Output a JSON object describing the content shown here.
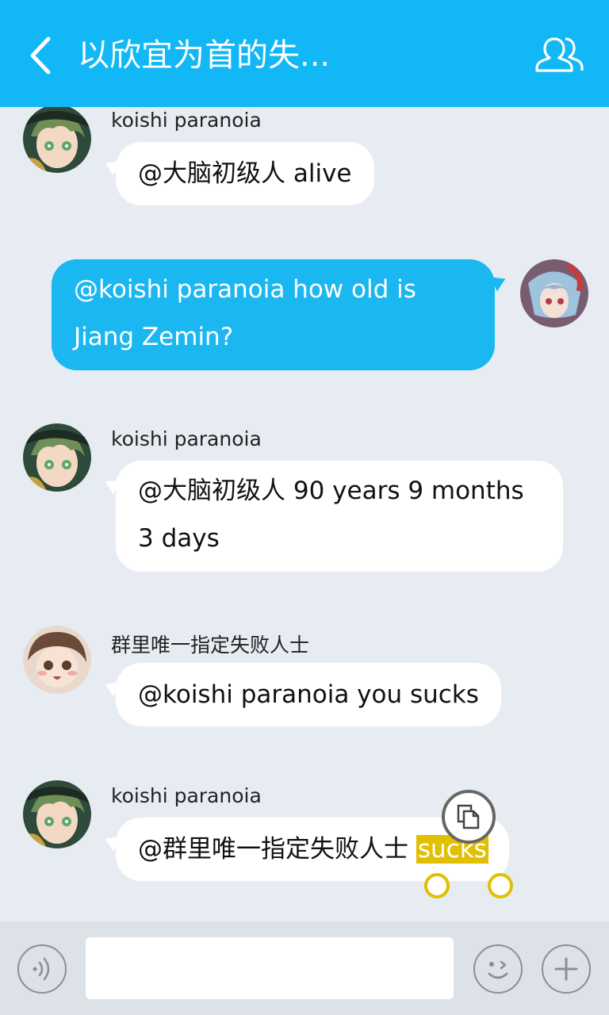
{
  "header": {
    "title": "以欣宜为首的失...",
    "back_icon": "chevron-left-icon",
    "group_icon": "group-members-icon",
    "color": "#12b7f5"
  },
  "messages": [
    {
      "sender": "koishi paranoia",
      "text": "@大脑初级人 alive",
      "direction": "incoming"
    },
    {
      "sender": "",
      "text": "@koishi paranoia how old is Jiang Zemin?",
      "direction": "outgoing"
    },
    {
      "sender": "koishi paranoia",
      "text": "@大脑初级人 90 years 9 months 3 days",
      "direction": "incoming"
    },
    {
      "sender": "群里唯一指定失败人士",
      "text": "@koishi paranoia you sucks",
      "direction": "incoming"
    },
    {
      "sender": "koishi paranoia",
      "text_prefix": "@群里唯一指定失败人士 ",
      "text_selected": "sucks",
      "direction": "incoming"
    }
  ],
  "selection": {
    "copy_icon": "copy-icon",
    "highlight_color": "#e0c000"
  },
  "bottom": {
    "voice_icon": "voice-icon",
    "emoji_icon": "emoji-icon",
    "plus_icon": "plus-icon",
    "input_value": ""
  }
}
